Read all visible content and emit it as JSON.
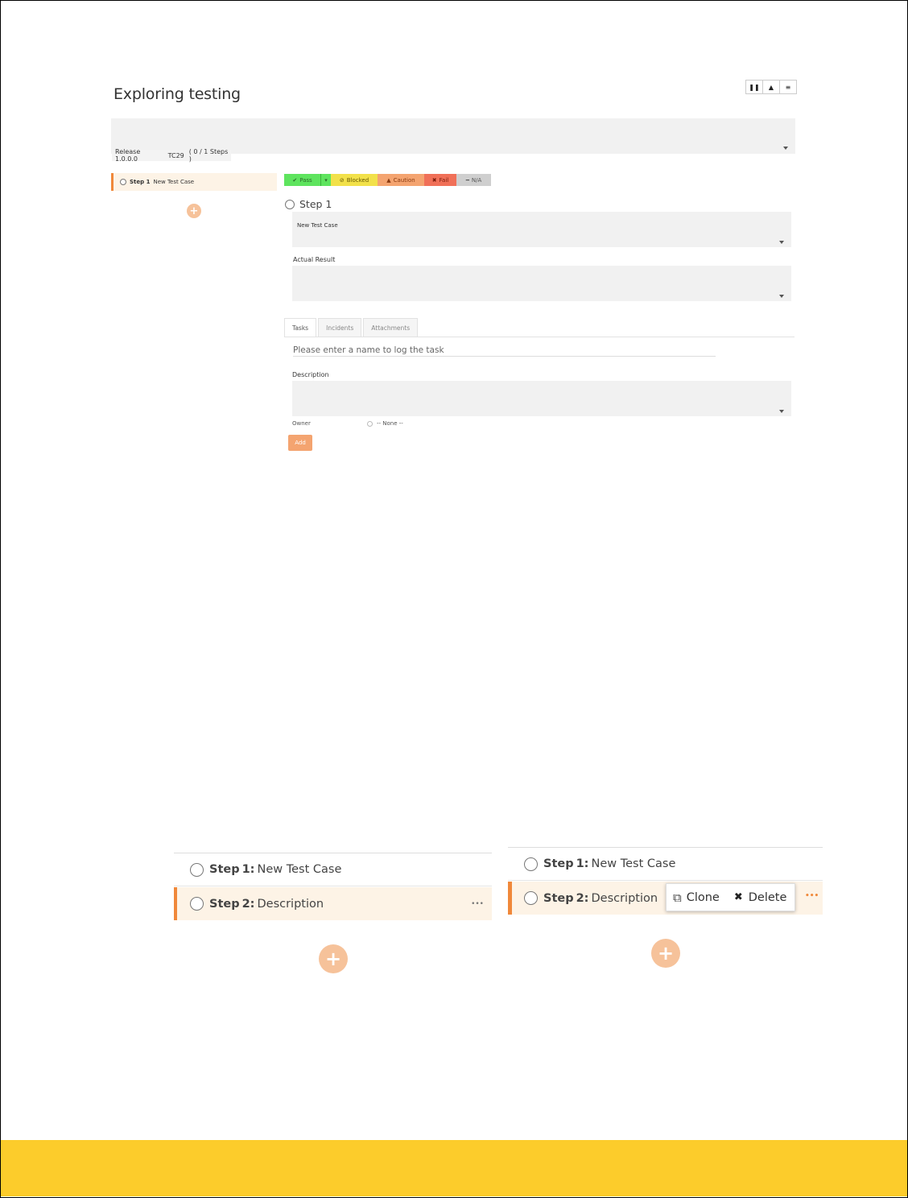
{
  "page": {
    "title": "Exploring testing"
  },
  "view_toggle": {
    "icons": [
      "pause-columns-icon",
      "eject-icon",
      "list-icon"
    ],
    "glyphs": [
      "❚❚",
      "▲",
      "≡"
    ]
  },
  "info_bar": {
    "release": "Release 1.0.0.0",
    "test_case": "TC29",
    "steps": "( 0 / 1 Steps )"
  },
  "step_list": {
    "item": {
      "label": "Step 1",
      "text": "New Test Case"
    }
  },
  "status_bar": {
    "pass": "Pass",
    "blocked": "Blocked",
    "caution": "Caution",
    "fail": "Fail",
    "na": "N/A",
    "colors": {
      "pass": "#5ee45e",
      "blocked": "#f2e14a",
      "caution": "#f4a470",
      "fail": "#f07058",
      "na": "#cfcfcf"
    }
  },
  "step_detail": {
    "heading": "Step 1",
    "description_value": "New Test Case",
    "actual_result_label": "Actual Result"
  },
  "tabs": [
    "Tasks",
    "Incidents",
    "Attachments"
  ],
  "task_form": {
    "name_placeholder": "Please enter a name to log the task",
    "description_label": "Description",
    "owner_label": "Owner",
    "owner_value": "-- None --",
    "add_label": "Add"
  },
  "zoom_left": {
    "step1": {
      "label": "Step",
      "num": "1:",
      "text": "New Test Case"
    },
    "step2": {
      "label": "Step",
      "num": "2:",
      "text": "Description"
    },
    "more": "•••"
  },
  "zoom_right": {
    "step1": {
      "label": "Step",
      "num": "1:",
      "text": "New Test Case"
    },
    "step2": {
      "label": "Step",
      "num": "2:",
      "text": "Description"
    },
    "clone": "Clone",
    "delete": "Delete",
    "more": "•••"
  },
  "colors": {
    "accent": "#f0883a",
    "footer": "#fccc2b",
    "plus": "#f6c29a"
  }
}
